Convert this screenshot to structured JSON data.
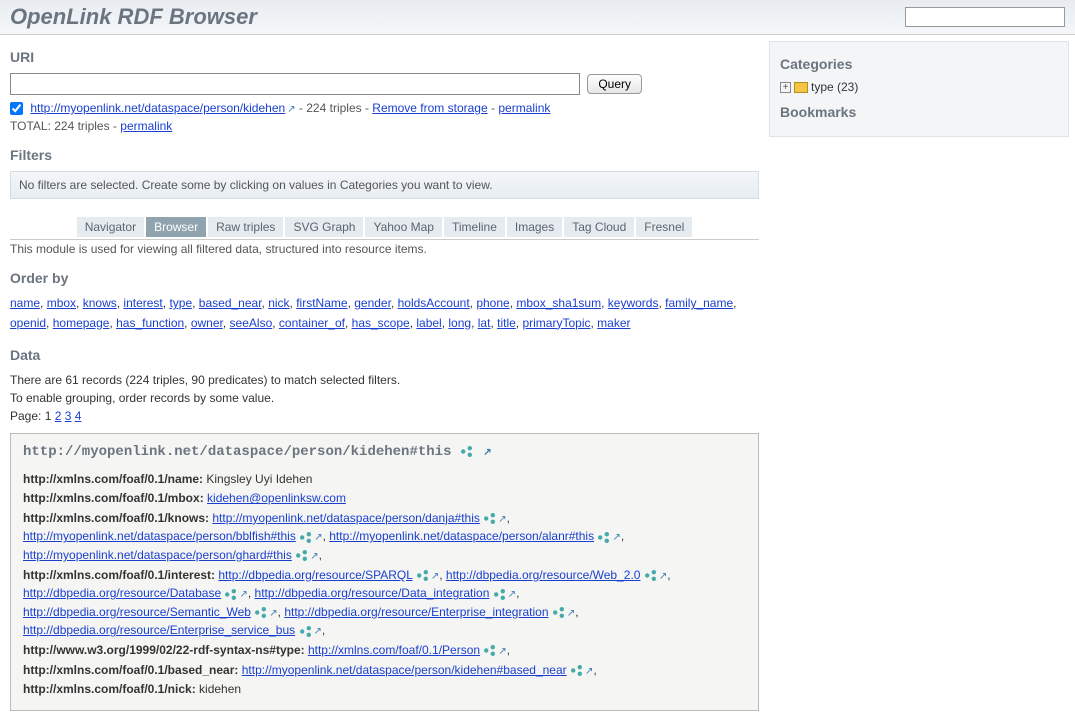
{
  "header": {
    "title": "OpenLink RDF Browser"
  },
  "uri": {
    "heading": "URI",
    "query_btn": "Query",
    "loaded_url": "http://myopenlink.net/dataspace/person/kidehen",
    "loaded_suffix": " - 224 triples - ",
    "remove_link": "Remove from storage",
    "permalink": "permalink",
    "total_prefix": "TOTAL: 224 triples - "
  },
  "filters": {
    "heading": "Filters",
    "none_text": "No filters are selected. Create some by clicking on values in Categories you want to view."
  },
  "tabs": [
    "Navigator",
    "Browser",
    "Raw triples",
    "SVG Graph",
    "Yahoo Map",
    "Timeline",
    "Images",
    "Tag Cloud",
    "Fresnel"
  ],
  "active_tab": 1,
  "module_desc": "This module is used for viewing all filtered data, structured into resource items.",
  "orderby": {
    "heading": "Order by",
    "items": [
      "name",
      "mbox",
      "knows",
      "interest",
      "type",
      "based_near",
      "nick",
      "firstName",
      "gender",
      "holdsAccount",
      "phone",
      "mbox_sha1sum",
      "keywords",
      "family_name",
      "openid",
      "homepage",
      "has_function",
      "owner",
      "seeAlso",
      "container_of",
      "has_scope",
      "label",
      "long",
      "lat",
      "title",
      "primaryTopic",
      "maker"
    ]
  },
  "data": {
    "heading": "Data",
    "summary": "There are 61 records (224 triples, 90 predicates) to match selected filters.",
    "grouping_hint": "To enable grouping, order records by some value.",
    "page_label": "Page: ",
    "current_page": "1",
    "pages": [
      "2",
      "3",
      "4"
    ]
  },
  "record": {
    "title": "http://myopenlink.net/dataspace/person/kidehen#this",
    "lines": [
      {
        "pred": "http://xmlns.com/foaf/0.1/name:",
        "text": " Kingsley Uyi Idehen"
      },
      {
        "pred": "http://xmlns.com/foaf/0.1/mbox:",
        "links": [
          {
            "t": "kidehen@openlinksw.com",
            "plain": true
          }
        ]
      },
      {
        "pred": "http://xmlns.com/foaf/0.1/knows:",
        "links": [
          {
            "t": "http://myopenlink.net/dataspace/person/danja#this"
          },
          {
            "t": "http://myopenlink.net/dataspace/person/bblfish#this"
          },
          {
            "t": "http://myopenlink.net/dataspace/person/alanr#this"
          },
          {
            "t": "http://myopenlink.net/dataspace/person/ghard#this"
          }
        ]
      },
      {
        "pred": "http://xmlns.com/foaf/0.1/interest:",
        "links": [
          {
            "t": "http://dbpedia.org/resource/SPARQL"
          },
          {
            "t": "http://dbpedia.org/resource/Web_2.0"
          },
          {
            "t": "http://dbpedia.org/resource/Database"
          },
          {
            "t": "http://dbpedia.org/resource/Data_integration"
          },
          {
            "t": "http://dbpedia.org/resource/Semantic_Web"
          },
          {
            "t": "http://dbpedia.org/resource/Enterprise_integration"
          },
          {
            "t": "http://dbpedia.org/resource/Enterprise_service_bus"
          }
        ]
      },
      {
        "pred": "http://www.w3.org/1999/02/22-rdf-syntax-ns#type:",
        "links": [
          {
            "t": "http://xmlns.com/foaf/0.1/Person"
          }
        ]
      },
      {
        "pred": "http://xmlns.com/foaf/0.1/based_near:",
        "links": [
          {
            "t": "http://myopenlink.net/dataspace/person/kidehen#based_near"
          }
        ]
      },
      {
        "pred": "http://xmlns.com/foaf/0.1/nick:",
        "text": " kidehen"
      }
    ]
  },
  "sidebar": {
    "categories_heading": "Categories",
    "cat_item": "type (23)",
    "bookmarks_heading": "Bookmarks"
  }
}
